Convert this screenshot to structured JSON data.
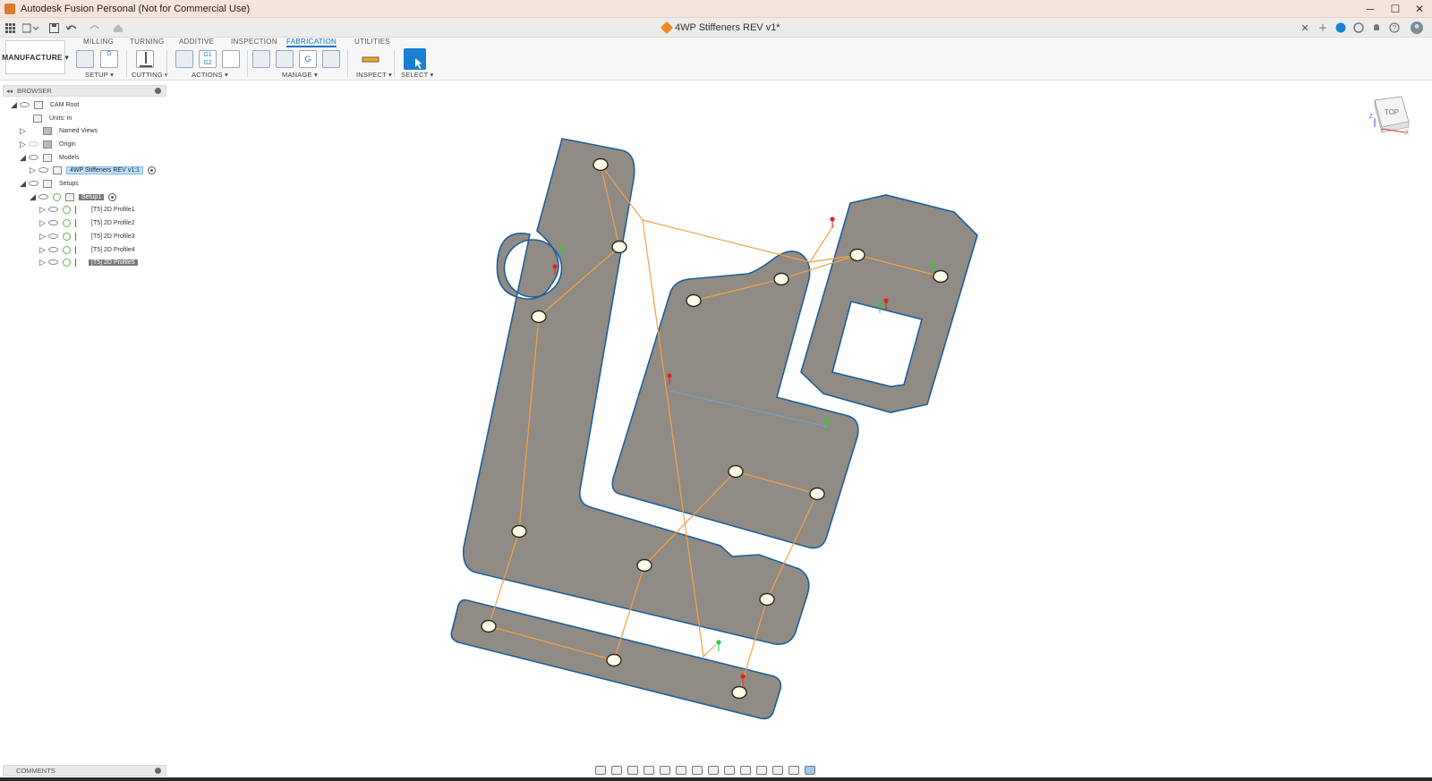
{
  "window": {
    "title": "Autodesk Fusion Personal (Not for Commercial Use)",
    "controls": [
      "─",
      "☐",
      "✕"
    ]
  },
  "document": {
    "tab_title": "4WP Stiffeners REV v1*"
  },
  "toolbar": {
    "workspace": "MANUFACTURE",
    "tabs": [
      "MILLING",
      "TURNING",
      "ADDITIVE",
      "INSPECTION",
      "FABRICATION",
      "UTILITIES"
    ],
    "active_tab": "FABRICATION",
    "groups": {
      "setup": "SETUP ▾",
      "cutting": "CUTTING ▾",
      "actions": "ACTIONS ▾",
      "manage": "MANAGE ▾",
      "inspect": "INSPECT ▾",
      "select": "SELECT ▾"
    },
    "icon_text": {
      "nc_code_1": "G1",
      "nc_code_2": "G2",
      "gcode": "G"
    }
  },
  "browser": {
    "header": "BROWSER",
    "nodes": {
      "cam_root": "CAM Root",
      "units": "Units: in",
      "named_views": "Named Views",
      "origin": "Origin",
      "models": "Models",
      "model": "4WP Stiffeners REV v1:1",
      "setups": "Setups",
      "setup1": "Setup1",
      "profile1": "[T5] 2D Profile1",
      "profile2": "[T5] 2D Profile2",
      "profile3": "[T5] 2D Profile3",
      "profile4": "[T5] 2D Profile4",
      "profile5": "[T5] 2D Profile5"
    }
  },
  "comments": {
    "header": "COMMENTS"
  },
  "viewcube": {
    "face": "TOP",
    "axis_z": "Z",
    "axis_x": "X"
  },
  "colors": {
    "part_fill": "#908b84",
    "part_edge": "#1f5f9a",
    "toolpath": "#f5a04a",
    "hole_fill": "#fffdea",
    "accent": "#0a74c9",
    "start_marker": "#e0231f",
    "end_marker": "#3cc23c"
  }
}
